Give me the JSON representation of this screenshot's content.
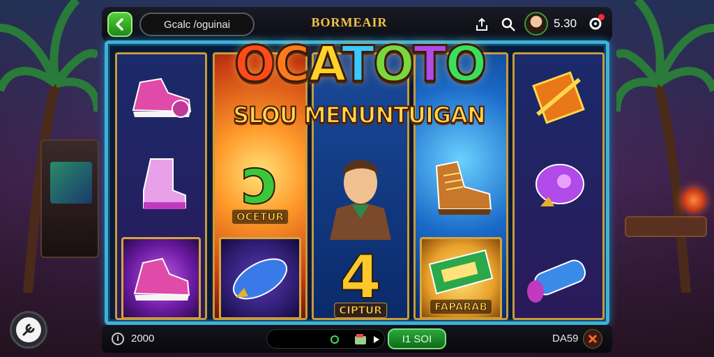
{
  "topbar": {
    "back_icon": "chevron-left-icon",
    "user_label": "Gcalc /oguinai",
    "game_title": "BORMEAIR",
    "balance": "5.30"
  },
  "logo": {
    "letters": [
      "O",
      "C",
      "A",
      "T",
      "O",
      "T",
      "O"
    ],
    "colors": [
      "#ff4a1a",
      "#ff7a1a",
      "#ffd22a",
      "#3ac8ff",
      "#7ad83a",
      "#b04ae8",
      "#3ae05a"
    ],
    "subtitle": "SLOU MENUNTUIGAN"
  },
  "reels": {
    "reel2_glyph": "ɔ",
    "reel2_label": "OCETUR",
    "reel3_glyph": "4",
    "reel3_label": "CIPTUR",
    "reel4_label": "FAPARAB"
  },
  "bottombar": {
    "credit": "2000",
    "spin_label": "I1 SOI",
    "bet_label": "DA59"
  },
  "colors": {
    "accent_green": "#2aa83a",
    "frame_blue": "#3fb0d8",
    "gold": "#d4a640"
  }
}
